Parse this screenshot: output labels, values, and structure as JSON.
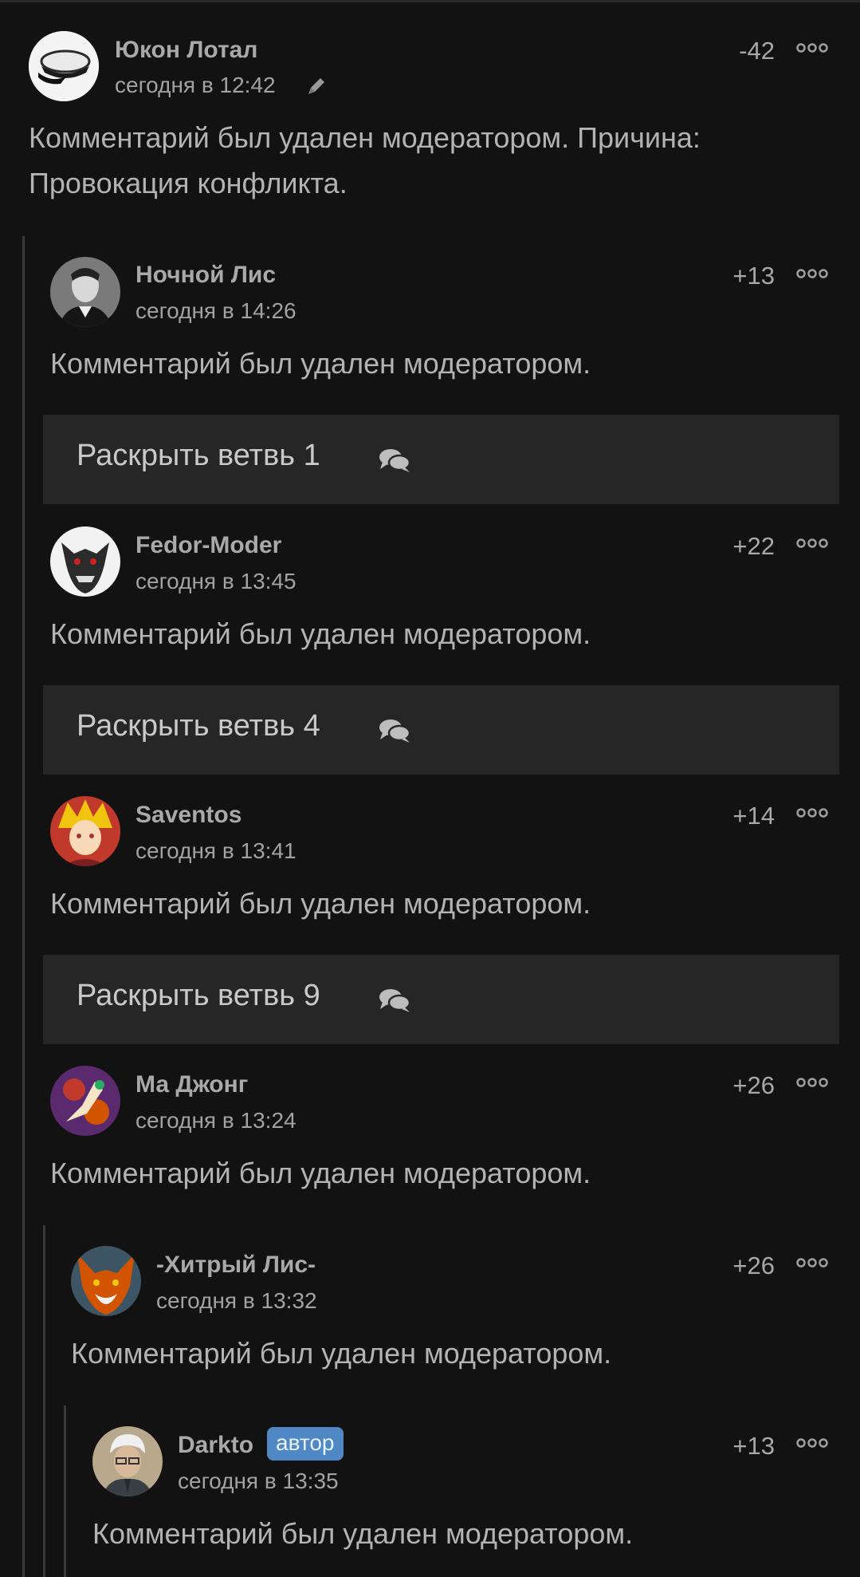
{
  "comments": [
    {
      "author": "Юкон Лотал",
      "time": "сегодня в 12:42",
      "rating": "-42",
      "text": "Комментарий был удален модератором. Причина: Провокация конфликта.",
      "edited_icon": "pencil-icon"
    },
    {
      "author": "Ночной Лис",
      "time": "сегодня в 14:26",
      "rating": "+13",
      "text": "Комментарий был удален модератором."
    },
    {
      "author": "Fedor-Moder",
      "time": "сегодня в 13:45",
      "rating": "+22",
      "text": "Комментарий был удален модератором."
    },
    {
      "author": "Saventos",
      "time": "сегодня в 13:41",
      "rating": "+14",
      "text": "Комментарий был удален модератором."
    },
    {
      "author": "Ма Джонг",
      "time": "сегодня в 13:24",
      "rating": "+26",
      "text": "Комментарий был удален модератором."
    },
    {
      "author": "-Хитрый Лис-",
      "time": "сегодня в 13:32",
      "rating": "+26",
      "text": "Комментарий был удален модератором."
    },
    {
      "author": "Darkto",
      "badge": "автор",
      "time": "сегодня в 13:35",
      "rating": "+13",
      "text": "Комментарий был удален модератором."
    }
  ],
  "branches": [
    {
      "label": "Раскрыть ветвь 1",
      "icon": "comments-icon"
    },
    {
      "label": "Раскрыть ветвь 4",
      "icon": "comments-icon"
    },
    {
      "label": "Раскрыть ветвь 9",
      "icon": "comments-icon"
    }
  ],
  "more_icon": "more-options-icon",
  "colors": {
    "background": "#121212",
    "branch_bg": "#262626",
    "badge": "#4f88c4",
    "text": "#b3b3b3"
  }
}
